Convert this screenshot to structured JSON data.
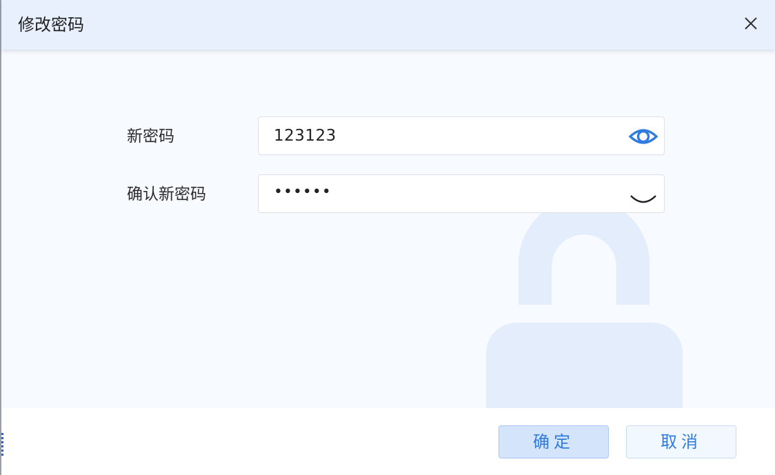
{
  "dialog": {
    "title": "修改密码",
    "close_icon": "close-icon"
  },
  "form": {
    "new_password": {
      "label": "新密码",
      "value": "123123",
      "visibility_icon": "eye-open-icon"
    },
    "confirm_password": {
      "label": "确认新密码",
      "value": "••••••",
      "visibility_icon": "eye-closed-icon"
    }
  },
  "footer": {
    "confirm_label": "确定",
    "cancel_label": "取消"
  },
  "colors": {
    "accent": "#2f7be0",
    "header_bg": "#e8f0fd",
    "watermark": "#e3edfc"
  },
  "decoration": {
    "watermark_icon": "lock-icon"
  }
}
